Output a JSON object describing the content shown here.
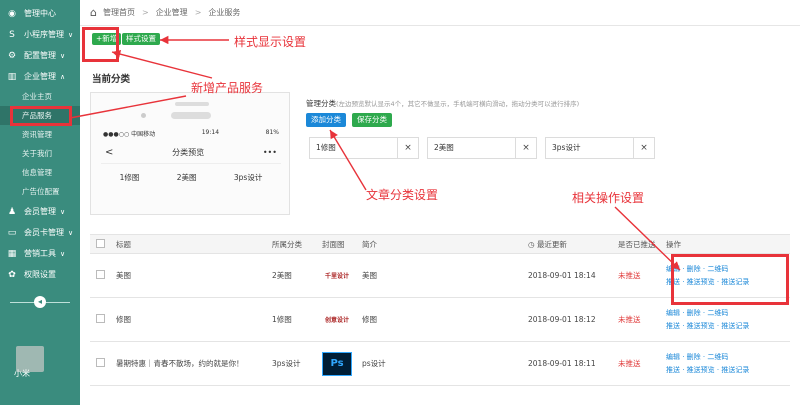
{
  "sidebar": {
    "items": [
      {
        "icon": "dashboard-icon",
        "glyph": "◉",
        "label": "管理中心",
        "chev": ""
      },
      {
        "icon": "miniapp-icon",
        "glyph": "S",
        "label": "小程序管理",
        "chev": "∨"
      },
      {
        "icon": "settings-icon",
        "glyph": "⚙",
        "label": "配置管理",
        "chev": "∨"
      },
      {
        "icon": "enterprise-icon",
        "glyph": "▥",
        "label": "企业管理",
        "chev": "∧"
      }
    ],
    "subitems": [
      "企业主页",
      "产品服务",
      "资讯管理",
      "关于我们",
      "信息管理",
      "广告位配置"
    ],
    "items2": [
      {
        "icon": "member-icon",
        "glyph": "♟",
        "label": "会员管理",
        "chev": "∨"
      },
      {
        "icon": "card-icon",
        "glyph": "▭",
        "label": "会员卡管理",
        "chev": "∨"
      },
      {
        "icon": "marketing-icon",
        "glyph": "▦",
        "label": "营销工具",
        "chev": "∨"
      },
      {
        "icon": "permission-icon",
        "glyph": "✿",
        "label": "权限设置",
        "chev": ""
      }
    ],
    "user": "小米"
  },
  "breadcrumb": [
    "管理首页",
    "企业管理",
    "企业服务"
  ],
  "toolbar": {
    "add_label": "+新增",
    "style_label": "样式设置"
  },
  "annotations": {
    "style": "样式显示设置",
    "add": "新增产品服务",
    "category": "文章分类设置",
    "ops": "相关操作设置"
  },
  "current_category_title": "当前分类",
  "phone": {
    "carrier": "●●●○○ 中国移动",
    "wifi": "WiFi",
    "time": "19:14",
    "battery": "81%",
    "back": "<",
    "title": "分类预览",
    "more": "•••",
    "cats": [
      "1修图",
      "2美图",
      "3ps设计"
    ]
  },
  "manage": {
    "title": "管理分类",
    "hint": "(左边预览默认显示4个，其它不做显示，手机端可横向滑动，拖动分类可以进行排序)",
    "add_btn": "添加分类",
    "save_btn": "保存分类",
    "inputs": [
      "1修图",
      "2美图",
      "3ps设计"
    ]
  },
  "table": {
    "headers": [
      "标题",
      "所属分类",
      "封面图",
      "简介",
      "最近更新",
      "是否已推送",
      "操作"
    ],
    "rows": [
      {
        "title": "美图",
        "cat": "2美图",
        "cover": "千里设计",
        "intro": "美图",
        "time": "2018-09-01 18:14",
        "push": "未推送",
        "ops1": "编辑 · 删除 · 二维码",
        "ops2": "推送 · 推送预览 · 推送记录"
      },
      {
        "title": "修图",
        "cat": "1修图",
        "cover": "创意设计",
        "intro": "修图",
        "time": "2018-09-01 18:12",
        "push": "未推送",
        "ops1": "编辑 · 删除 · 二维码",
        "ops2": "推送 · 推送预览 · 推送记录"
      },
      {
        "title": "暑期特惠｜青春不散场，约的就是你！",
        "cat": "3ps设计",
        "cover": "Ps",
        "intro": "ps设计",
        "time": "2018-09-01 18:11",
        "push": "未推送",
        "ops1": "编辑 · 删除 · 二维码",
        "ops2": "推送 · 推送预览 · 推送记录"
      }
    ]
  },
  "colors": {
    "sidebar": "#3a8c7e",
    "accent_green": "#2ea94d",
    "accent_blue": "#1b88d8",
    "annotation_red": "#e8333a"
  }
}
